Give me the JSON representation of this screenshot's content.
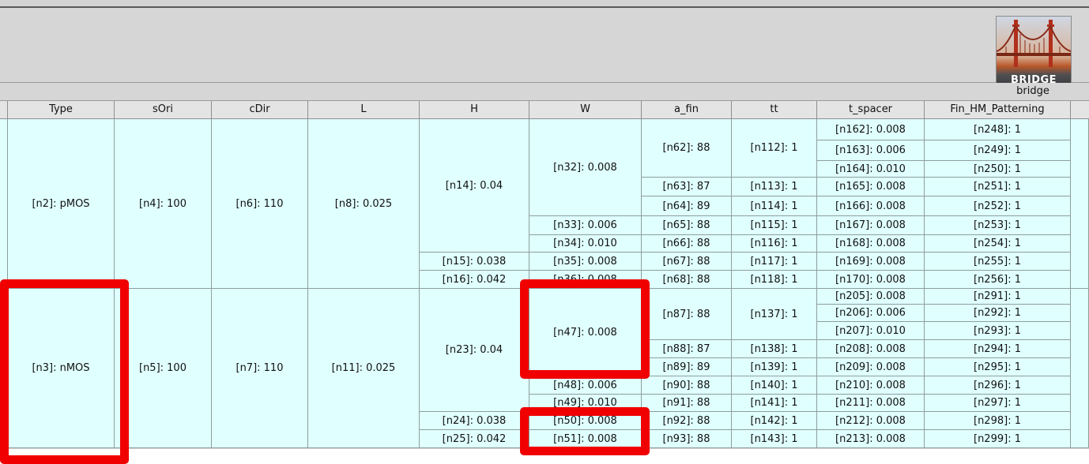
{
  "app": {
    "logo_text": "BRIDGE",
    "panel_label": "bridge"
  },
  "columns": [
    "Type",
    "sOri",
    "cDir",
    "L",
    "H",
    "W",
    "a_fin",
    "tt",
    "t_spacer",
    "Fin_HM_Patterning"
  ],
  "pmos": {
    "type": "[n2]: pMOS",
    "sori": "[n4]: 100",
    "cdir": "[n6]: 110",
    "l": "[n8]: 0.025",
    "h": [
      "[n14]: 0.04",
      "[n15]: 0.038",
      "[n16]: 0.042"
    ],
    "w": [
      "[n32]: 0.008",
      "[n33]: 0.006",
      "[n34]: 0.010",
      "[n35]: 0.008",
      "[n36]: 0.008"
    ],
    "a_fin": [
      "[n62]: 88",
      "[n63]: 87",
      "[n64]: 89",
      "[n65]: 88",
      "[n66]: 88",
      "[n67]: 88",
      "[n68]: 88"
    ],
    "tt": [
      "[n112]: 1",
      "[n113]: 1",
      "[n114]: 1",
      "[n115]: 1",
      "[n116]: 1",
      "[n117]: 1",
      "[n118]: 1"
    ],
    "t_spacer": [
      "[n162]: 0.008",
      "[n163]: 0.006",
      "[n164]: 0.010",
      "[n165]: 0.008",
      "[n166]: 0.008",
      "[n167]: 0.008",
      "[n168]: 0.008",
      "[n169]: 0.008",
      "[n170]: 0.008"
    ],
    "fin": [
      "[n248]: 1",
      "[n249]: 1",
      "[n250]: 1",
      "[n251]: 1",
      "[n252]: 1",
      "[n253]: 1",
      "[n254]: 1",
      "[n255]: 1",
      "[n256]: 1"
    ]
  },
  "nmos": {
    "type": "[n3]: nMOS",
    "sori": "[n5]: 100",
    "cdir": "[n7]: 110",
    "l": "[n11]: 0.025",
    "h": [
      "[n23]: 0.04",
      "[n24]: 0.038",
      "[n25]: 0.042"
    ],
    "w": [
      "[n47]: 0.008",
      "[n48]: 0.006",
      "[n49]: 0.010",
      "[n50]: 0.008",
      "[n51]: 0.008"
    ],
    "a_fin": [
      "[n87]: 88",
      "[n88]: 87",
      "[n89]: 89",
      "[n90]: 88",
      "[n91]: 88",
      "[n92]: 88",
      "[n93]: 88"
    ],
    "tt": [
      "[n137]: 1",
      "[n138]: 1",
      "[n139]: 1",
      "[n140]: 1",
      "[n141]: 1",
      "[n142]: 1",
      "[n143]: 1"
    ],
    "t_spacer": [
      "[n205]: 0.008",
      "[n206]: 0.006",
      "[n207]: 0.010",
      "[n208]: 0.008",
      "[n209]: 0.008",
      "[n210]: 0.008",
      "[n211]: 0.008",
      "[n212]: 0.008",
      "[n213]: 0.008"
    ],
    "fin": [
      "[n291]: 1",
      "[n292]: 1",
      "[n293]: 1",
      "[n294]: 1",
      "[n295]: 1",
      "[n296]: 1",
      "[n297]: 1",
      "[n298]: 1",
      "[n299]: 1"
    ]
  },
  "colors": {
    "cell_bg": "#e0ffff",
    "highlight": "#f00000"
  }
}
